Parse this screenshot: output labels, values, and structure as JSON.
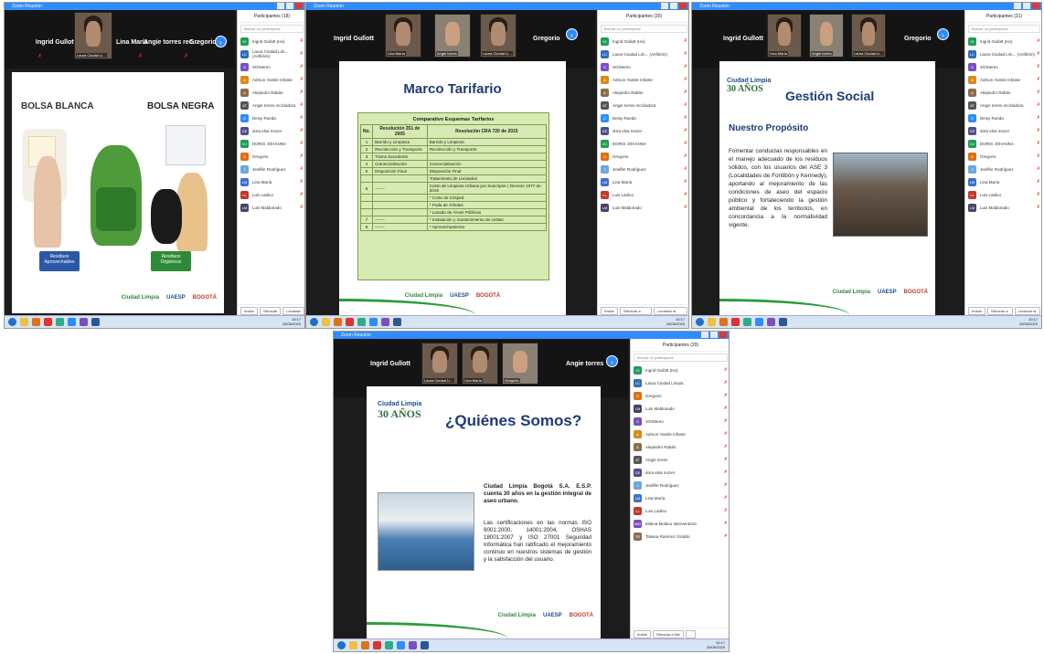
{
  "window_title": "Zoom Reunión",
  "colors": {
    "zoom_blue": "#2d8cff",
    "green": "#2e9c3c",
    "red_mic": "#e0301e"
  },
  "w1": {
    "names": [
      "Ingrid Gullott",
      "Lina María",
      "Angie torres rec...",
      "Gregorio"
    ],
    "tile_label": "Laura Ciudad Li...",
    "slide": {
      "left_title": "BOLSA BLANCA",
      "right_title": "BOLSA NEGRA",
      "left_tag": "Residuos Aprovechables",
      "right_tag": "Residuos Orgánicos",
      "logo1": "Ciudad Limpia",
      "logo2": "UAESP",
      "logo3": "BOGOTÁ"
    },
    "panel": {
      "title": "Participantes (18)",
      "search": "Buscar un participante",
      "rows": [
        {
          "name": "Ingrid Gullott (Ho)",
          "c": "#1e9c57",
          "i": "IG"
        },
        {
          "name": "Laura Ciudad Lim... (Anfitrión)",
          "c": "#2f6fb4",
          "i": "LC"
        },
        {
          "name": "SOStereo",
          "c": "#7a4fc2",
          "i": "S"
        },
        {
          "name": "Admon Yamile Infante",
          "c": "#d98b17",
          "i": "A"
        },
        {
          "name": "Alejandro Rabán",
          "c": "#8a6c4f",
          "i": "A"
        },
        {
          "name": "Angie torres recicladora",
          "c": "#555555",
          "i": "AT"
        },
        {
          "name": "Deisy Rueda",
          "c": "#2d8cff",
          "i": "D"
        },
        {
          "name": "dora elsa mozer",
          "c": "#4e4e8c",
          "i": "DE"
        },
        {
          "name": "DORIS JOHANNA",
          "c": "#1e9c57",
          "i": "DJ"
        },
        {
          "name": "Gregorio",
          "c": "#e06d10",
          "i": "G"
        },
        {
          "name": "Jeniffer Rodríguez",
          "c": "#6aa7e0",
          "i": "J"
        },
        {
          "name": "Lina María",
          "c": "#3a6fd0",
          "i": "LM"
        },
        {
          "name": "Luis Ladino",
          "c": "#c0392b",
          "i": "LL"
        },
        {
          "name": "Luis Maldonado",
          "c": "#444466",
          "i": "LM"
        }
      ],
      "footer": [
        "Invitar",
        "Silenciar a todos",
        "Levantar la mano"
      ]
    }
  },
  "w2": {
    "names": [
      "Ingrid Gullott",
      "Gregorio"
    ],
    "tiles": [
      "Lina María",
      "Angie torres",
      "Laura Ciudad Li..."
    ],
    "slide": {
      "title": "Marco Tarifario",
      "table_title": "Comparativo Esquemas Tarifarios",
      "headers": [
        "No.",
        "Resolución 351 de 2005",
        "Resolución CRA 720 de 2015"
      ],
      "rows": [
        [
          "1",
          "Barrido y Limpieza",
          "Barrido y Limpieza"
        ],
        [
          "2",
          "Recolección y Transporte",
          "Recolección y Transporte"
        ],
        [
          "3",
          "Tramo Excedente",
          ""
        ],
        [
          "4",
          "Comercialización",
          "Comercialización"
        ],
        [
          "5",
          "Disposición Final",
          "Disposición Final"
        ],
        [
          "",
          "",
          "Tratamiento de Lixiviados"
        ],
        [
          "6",
          "-------",
          "Costo de Limpieza Urbana por Suscriptor | Decreto 1077 de 2015"
        ],
        [
          "",
          "",
          "* Corte de Césped"
        ],
        [
          "",
          "",
          "* Poda de Árboles"
        ],
        [
          "",
          "",
          "* Lavado de Áreas Públicas"
        ],
        [
          "7",
          "-------",
          "* Instalación y mantenimiento de cestas"
        ],
        [
          "8",
          "-------",
          "* Aprovechamiento"
        ]
      ],
      "logo1": "Ciudad Limpia",
      "logo2": "UAESP",
      "logo3": "BOGOTÁ"
    },
    "panel": {
      "title": "Participantes (20)",
      "search": "Buscar un participante",
      "rows": [
        {
          "name": "Ingrid Gullott (Ho)",
          "c": "#1e9c57",
          "i": "IG"
        },
        {
          "name": "Laura Ciudad Lim... (Anfitrión)",
          "c": "#2f6fb4",
          "i": "LC"
        },
        {
          "name": "SOStereo",
          "c": "#7a4fc2",
          "i": "S"
        },
        {
          "name": "Admon Yamile Infante",
          "c": "#d98b17",
          "i": "A"
        },
        {
          "name": "Alejandro Rabán",
          "c": "#8a6c4f",
          "i": "A"
        },
        {
          "name": "Angie torres recicladora",
          "c": "#555555",
          "i": "AT"
        },
        {
          "name": "Deisy Rueda",
          "c": "#2d8cff",
          "i": "D"
        },
        {
          "name": "dora elsa mozer",
          "c": "#4e4e8c",
          "i": "DE"
        },
        {
          "name": "DORIS JOHANNA",
          "c": "#1e9c57",
          "i": "DJ"
        },
        {
          "name": "Gregorio",
          "c": "#e06d10",
          "i": "G"
        },
        {
          "name": "Jeniffer Rodríguez",
          "c": "#6aa7e0",
          "i": "J"
        },
        {
          "name": "Lina María",
          "c": "#3a6fd0",
          "i": "LM"
        },
        {
          "name": "Luis Ladino",
          "c": "#c0392b",
          "i": "LL"
        },
        {
          "name": "Luis Maldonado",
          "c": "#444466",
          "i": "LM"
        }
      ],
      "footer": [
        "Invitar",
        "Silenciar a todos",
        "Levantar la mano"
      ]
    }
  },
  "w3": {
    "names": [
      "Ingrid Gullott",
      "Gregorio"
    ],
    "tiles": [
      "Lina María",
      "Angie torres",
      "Laura Ciudad Li..."
    ],
    "slide": {
      "logo_years": "30 AÑOS",
      "title": "Gestión Social",
      "subtitle": "Nuestro Propósito",
      "body": "Fomentar conductas responsables en el manejo adecuado de los residuos sólidos, con los usuarios del ASE 3 (Localidades de Fontibón y Kennedy), aportando al mejoramiento de las condiciones de aseo del espacio público y fortaleciendo la gestión ambiental de los territorios, en concordancia a la normatividad vigente.",
      "logo1": "Ciudad Limpia",
      "logo2": "UAESP",
      "logo3": "BOGOTÁ"
    },
    "panel": {
      "title": "Participantes (21)",
      "search": "Buscar un participante",
      "rows": [
        {
          "name": "Ingrid Gullott (Ho)",
          "c": "#1e9c57",
          "i": "IG"
        },
        {
          "name": "Laura Ciudad Lim... (Anfitrión)",
          "c": "#2f6fb4",
          "i": "LC"
        },
        {
          "name": "SOStereo",
          "c": "#7a4fc2",
          "i": "S"
        },
        {
          "name": "Admon Yamile Infante",
          "c": "#d98b17",
          "i": "A"
        },
        {
          "name": "Alejandro Rabán",
          "c": "#8a6c4f",
          "i": "A"
        },
        {
          "name": "Angie torres recicladora",
          "c": "#555555",
          "i": "AT"
        },
        {
          "name": "Deisy Rueda",
          "c": "#2d8cff",
          "i": "D"
        },
        {
          "name": "dora elsa mozer",
          "c": "#4e4e8c",
          "i": "DE"
        },
        {
          "name": "DORIS JOHANNA",
          "c": "#1e9c57",
          "i": "DJ"
        },
        {
          "name": "Gregorio",
          "c": "#e06d10",
          "i": "G"
        },
        {
          "name": "Jeniffer Rodríguez",
          "c": "#6aa7e0",
          "i": "J"
        },
        {
          "name": "Lina María",
          "c": "#3a6fd0",
          "i": "LM"
        },
        {
          "name": "Luis Ladino",
          "c": "#c0392b",
          "i": "LL"
        },
        {
          "name": "Luis Maldonado",
          "c": "#444466",
          "i": "LM"
        }
      ],
      "footer": [
        "Invitar",
        "Silenciar a todos",
        "Levantar la mano"
      ]
    }
  },
  "w4": {
    "names": [
      "Ingrid Gullott",
      "Angie torres"
    ],
    "tiles": [
      "Laura Ciudad Li...",
      "Lina María",
      "Gregorio"
    ],
    "slide": {
      "logo_years": "30 AÑOS",
      "title": "¿Quiénes Somos?",
      "p1": "Ciudad Limpia Bogotá S.A. E.S.P. cuenta 30 años en la gestión integral de aseo urbano.",
      "p2": "Las certificaciones en las normas ISO 9001:2000, 14001:2004, OSHAS 18001:2007 y ISO 27001 Seguridad Informática han ratificado el mejoramiento continuo en nuestros sistemas de gestión y la satisfacción del usuario.",
      "logo1": "Ciudad Limpia",
      "logo2": "UAESP",
      "logo3": "BOGOTÁ"
    },
    "panel": {
      "title": "Participantes (20)",
      "search": "Buscar un participante",
      "rows": [
        {
          "name": "Ingrid Gullott (Ho)",
          "c": "#1e9c57",
          "i": "IG"
        },
        {
          "name": "Laura Ciudad Limpia",
          "c": "#2f6fb4",
          "i": "LC"
        },
        {
          "name": "Gregorio",
          "c": "#e06d10",
          "i": "G"
        },
        {
          "name": "Luis Maldonado",
          "c": "#444466",
          "i": "LM"
        },
        {
          "name": "SOStereo",
          "c": "#7a4fc2",
          "i": "S"
        },
        {
          "name": "Admon Yamile Infante",
          "c": "#d98b17",
          "i": "A"
        },
        {
          "name": "Alejandro Rabán",
          "c": "#8a6c4f",
          "i": "A"
        },
        {
          "name": "Angie torres",
          "c": "#555555",
          "i": "AT"
        },
        {
          "name": "dora elsa mozer",
          "c": "#4e4e8c",
          "i": "DE"
        },
        {
          "name": "Jeniffer Rodríguez",
          "c": "#6aa7e0",
          "i": "J"
        },
        {
          "name": "Lina María",
          "c": "#3a6fd0",
          "i": "LM"
        },
        {
          "name": "Luis Ladino",
          "c": "#c0392b",
          "i": "LL"
        },
        {
          "name": "Milena Molano Interventoría",
          "c": "#7a4fc2",
          "i": "MM"
        },
        {
          "name": "Tatiana Ramírez Giraldo",
          "c": "#8a6c4f",
          "i": "TR"
        }
      ],
      "footer": [
        "Invitar",
        "Silenciar a Mic",
        "..."
      ]
    }
  },
  "clock": {
    "time": "10:17",
    "date": "26/06/2020"
  }
}
